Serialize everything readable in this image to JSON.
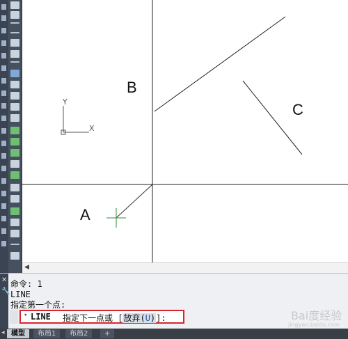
{
  "canvas": {
    "labels": {
      "a": "A",
      "b": "B",
      "c": "C"
    },
    "ucs": {
      "x_label": "X",
      "y_label": "Y"
    }
  },
  "command": {
    "history": [
      "命令: 1",
      "LINE",
      "指定第一个点:"
    ],
    "input": {
      "command_name": "LINE",
      "prompt_text": "指定下一点或 [",
      "option_prefix": "放弃(",
      "option_key": "U",
      "option_suffix": ")",
      "prompt_end": "]:"
    }
  },
  "tabs": {
    "model": "模型",
    "layout1": "布局1",
    "layout2": "布局2",
    "add": "+"
  },
  "watermark": {
    "text": "Bai度经验",
    "url": "jingyan.baidu.com"
  },
  "icons": {
    "close": "close-icon",
    "wrench": "wrench-icon",
    "scroll_left": "scroll-left-icon",
    "cursor": "crosshair-cursor-icon"
  },
  "colors": {
    "highlight_border": "#d7262b",
    "toolbar_dark": "#3b4453",
    "cursor_green": "#2f8f3a"
  }
}
